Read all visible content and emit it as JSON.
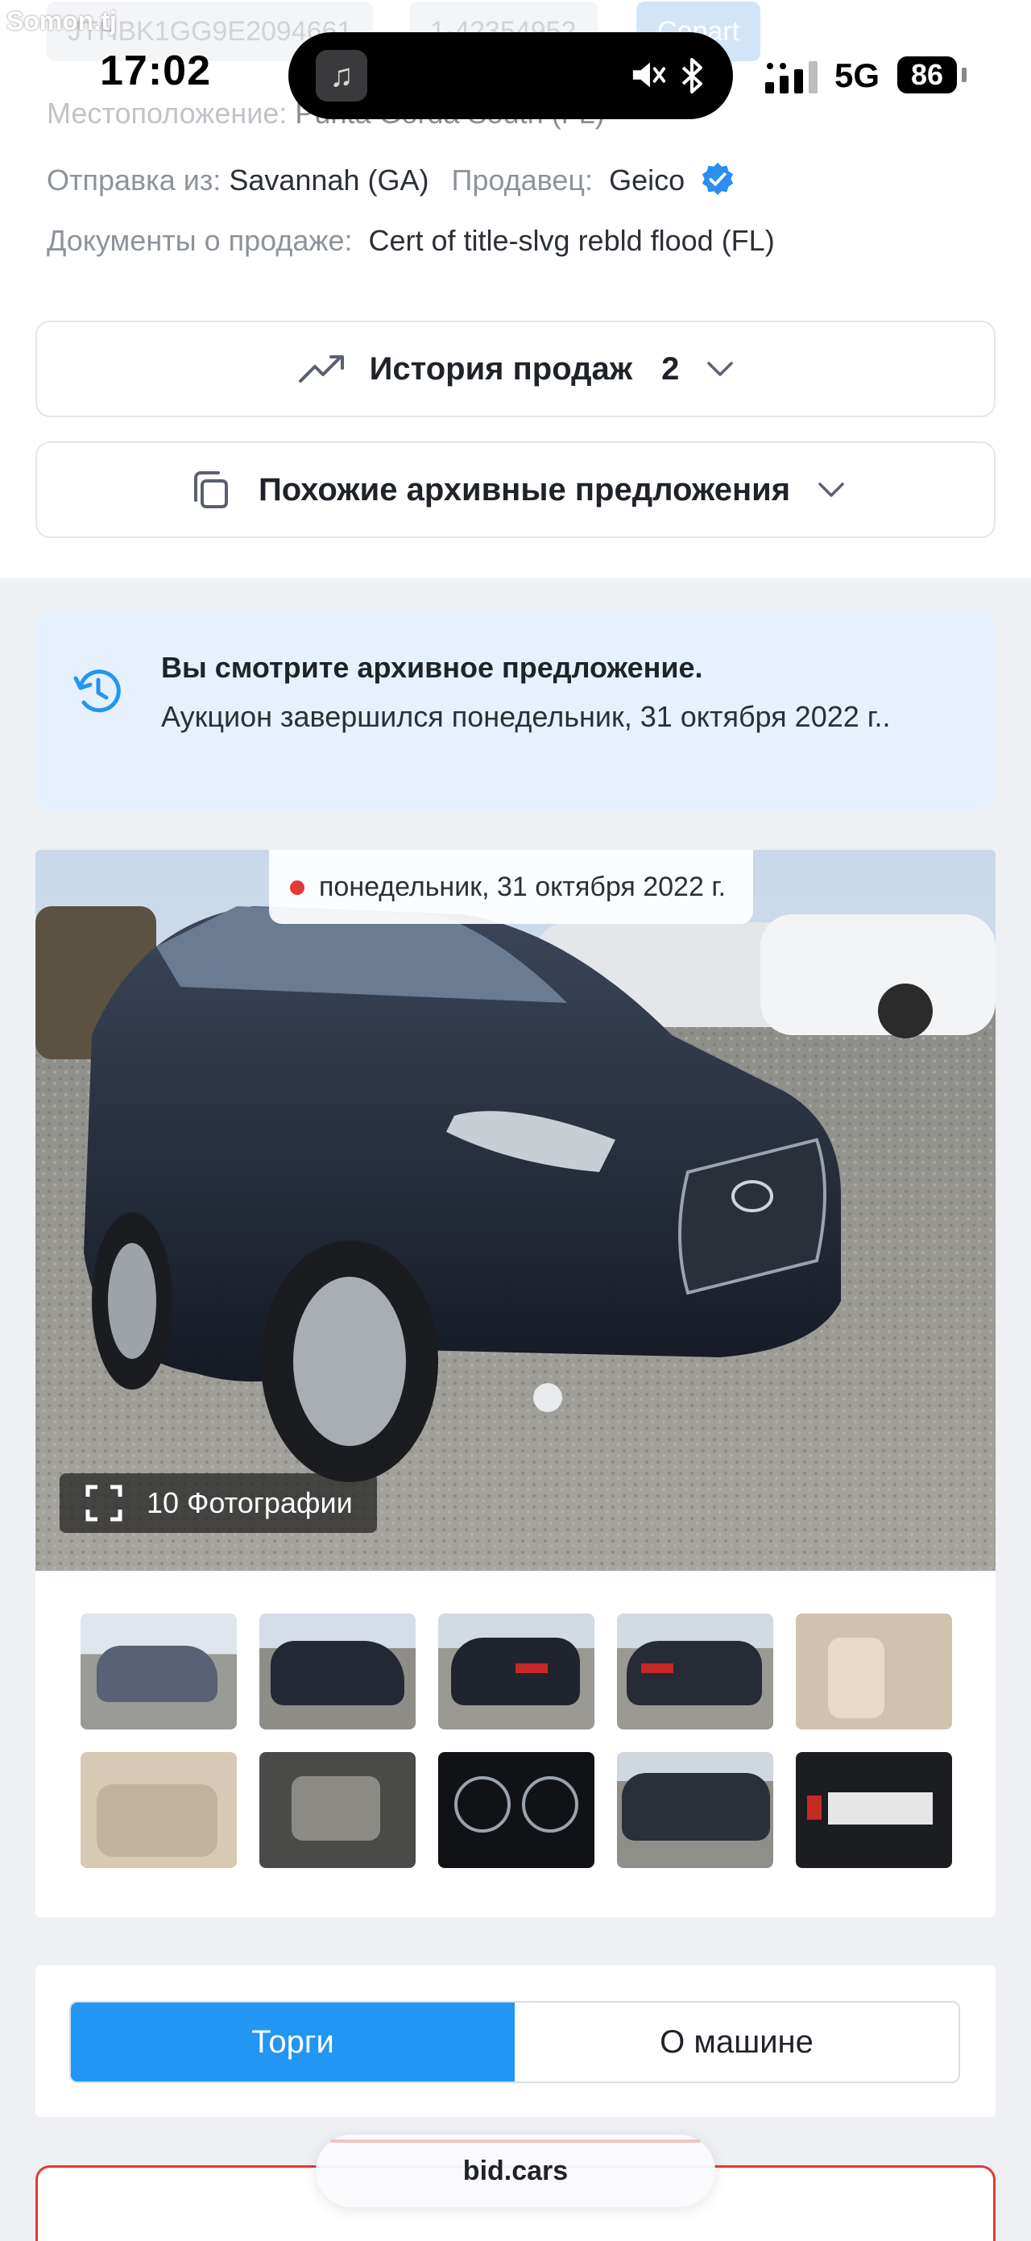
{
  "status": {
    "time": "17:02",
    "network": "5G",
    "battery": "86",
    "watermark": "Somon.tj"
  },
  "top_strip": {
    "vin": "JTHBK1GG9E2094661",
    "number": "1-42354952",
    "source_button": "Copart"
  },
  "details": {
    "location_label": "Местоположение:",
    "location_value": "Punta Gorda South (FL)",
    "ship_label": "Отправка из:",
    "ship_value": "Savannah (GA)",
    "seller_label": "Продавец:",
    "seller_value": "Geico",
    "docs_label": "Документы о продаже:",
    "docs_value": "Cert of title-slvg rebld flood (FL)"
  },
  "accordions": {
    "sales_history_label": "История продаж",
    "sales_history_count": "2",
    "similar_label": "Похожие архивные предложения"
  },
  "notice": {
    "title": "Вы смотрите архивное предложение.",
    "text": "Аукцион завершился понедельник, 31 октября 2022 г.."
  },
  "gallery": {
    "date": "понедельник, 31 октября 2022 г.",
    "photos_button": "10 Фотографии",
    "thumbnails": [
      "front-left",
      "front-left-2",
      "rear-left",
      "rear-left-2",
      "interior-front",
      "interior-rear",
      "engine",
      "dashboard",
      "side",
      "label"
    ]
  },
  "tabs": {
    "active": "Торги",
    "inactive": "О машине"
  },
  "browser": {
    "url": "bid.cars"
  },
  "colors": {
    "accent": "#2196f3",
    "notice_bg": "#e6f1fd",
    "alert_red": "#e53935"
  }
}
